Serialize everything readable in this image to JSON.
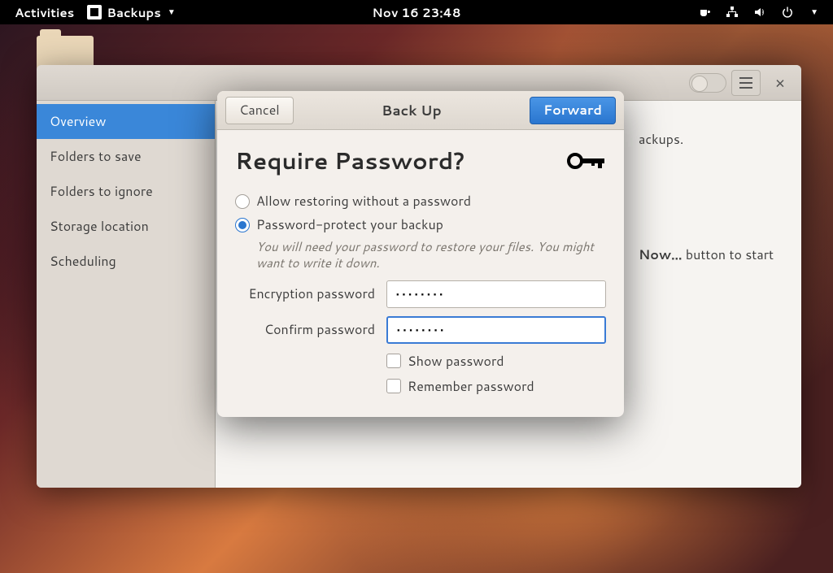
{
  "topbar": {
    "activities": "Activities",
    "app_name": "Backups",
    "clock": "Nov 16  23:48"
  },
  "window": {
    "sidebar": {
      "items": [
        {
          "label": "Overview",
          "active": true
        },
        {
          "label": "Folders to save",
          "active": false
        },
        {
          "label": "Folders to ignore",
          "active": false
        },
        {
          "label": "Storage location",
          "active": false
        },
        {
          "label": "Scheduling",
          "active": false
        }
      ]
    },
    "content": {
      "peek_top": "ackups.",
      "peek_mid_1": "Now…",
      "peek_mid_2": " button to start"
    }
  },
  "dialog": {
    "cancel": "Cancel",
    "title": "Back Up",
    "forward": "Forward",
    "heading": "Require Password?",
    "radio_nopass": "Allow restoring without a password",
    "radio_pass": "Password-protect your backup",
    "hint": "You will need your password to restore your files. You might want to write it down.",
    "field1_label": "Encryption password",
    "field1_value": "••••••••",
    "field2_label": "Confirm password",
    "field2_value": "••••••••",
    "show_pw": "Show password",
    "remember_pw": "Remember password"
  }
}
